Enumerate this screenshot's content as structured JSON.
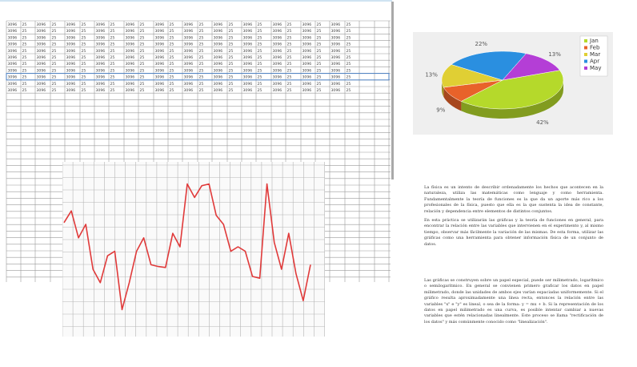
{
  "spreadsheet": {
    "row_values": [
      "3096",
      "25"
    ],
    "selected_row_index": 8
  },
  "line_chart": {
    "type": "line",
    "series": [
      {
        "values": [
          22,
          35,
          5,
          20,
          -30,
          -45,
          -15,
          -10,
          -75,
          -45,
          -10,
          5,
          -25,
          -27,
          -28,
          10,
          -5,
          65,
          50,
          63,
          65,
          30,
          20,
          -10,
          -5,
          -10,
          -38,
          -40,
          65,
          0,
          -30,
          10,
          -35,
          -65,
          -25
        ]
      }
    ],
    "color": "#e03a3a"
  },
  "chart_data": [
    {
      "type": "pie",
      "categories": [
        "Jan",
        "Feb",
        "Mar",
        "Apr",
        "May"
      ],
      "values": [
        42,
        9,
        13,
        22,
        13
      ],
      "labels": [
        "42%",
        "9%",
        "13%",
        "22%",
        "13%"
      ],
      "colors": [
        "#b5d92b",
        "#e8622a",
        "#e0cf34",
        "#2a8fe0",
        "#b43ed6"
      ],
      "legend": "right"
    }
  ],
  "paragraphs": [
    "La física es un intento de describir ordenadamente los hechos que acontecen en la naturaleza, utiliza las matemáticas como lenguaje y como herramienta. Fundamentalmente la teoría de funciones es la que da un aporte más rico a los profesionales de la física, puesto que ella es la que sustenta la idea de constante, relación y dependencia entre elementos de distintos conjuntos.",
    "En esta práctica se utilizarán las gráficas y la teoría de funciones en general, para encontrar la relación entre las variables que intervienen en el experimento y, al mismo tiempo, observar más fácilmente la variación de las mismas. De esta forma, utilizar las gráficas como una herramienta para obtener información física de un conjunto de datos.",
    "Las gráficas se construyen sobre un papel especial, puede ser milimetrado, logarítmico o semilogarítmico. En general se convienen primero graficar los datos en papel milimetrado, donde las unidades de ambos ejes varían espaciadas uniformemente. Si el gráfico resulta aproximadamente una línea recta, entonces la relación entre las variables \"x\" e \"y\" es lineal, o sea de la forma: y = mx + b. Si la representación de los datos en papel milimetrado es una curva, es posible intentar cambiar a nuevas variables que estén relacionadas linealmente. Este proceso se llama \"rectificación de los datos\" y más comúnmente conocido como \"linealización\"."
  ]
}
